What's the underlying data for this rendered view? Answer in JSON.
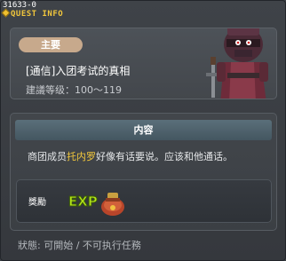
{
  "window": {
    "quest_id": "31633-0",
    "title": "QUEST INFO"
  },
  "quest": {
    "type_badge": "主要",
    "name": "[通信]入团考试的真相",
    "level": "建議等级：100～119"
  },
  "content": {
    "header": "内容",
    "text_before": "商团成员",
    "npc_name": "托内罗",
    "text_after": "好像有话要说。应该和他通话。"
  },
  "reward": {
    "label": "獎勵",
    "exp_text": "EXP"
  },
  "status": "狀態: 可開始 / 不可执行任務",
  "colors": {
    "title": "#f2c73c",
    "badge": "#c7a98c",
    "npc_link": "#f2c73c",
    "content_header": "#506470"
  },
  "icons": [
    "title-diamond-icon",
    "npc-portrait",
    "exp-icon",
    "reward-bag-icon"
  ]
}
